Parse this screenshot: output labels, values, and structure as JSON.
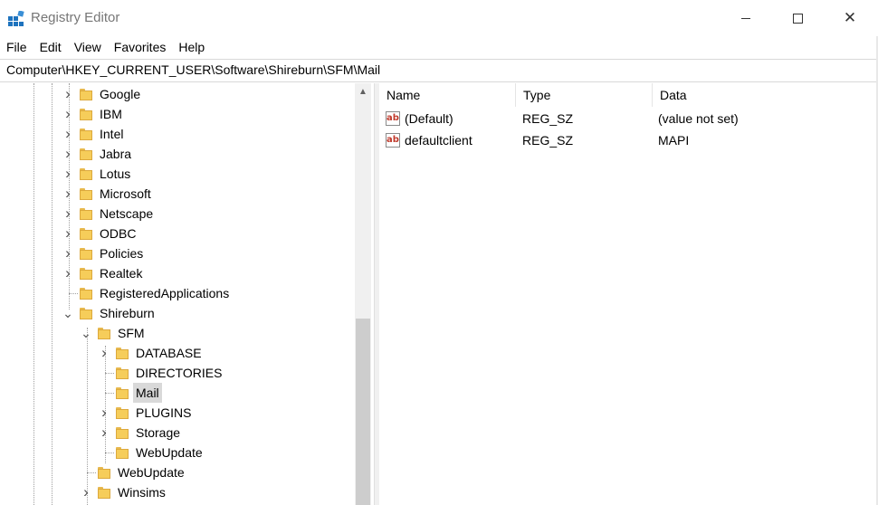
{
  "window": {
    "title": "Registry Editor",
    "icon": "registry-editor-icon",
    "controls": {
      "minimize": "minimize-icon",
      "maximize": "maximize-icon",
      "close": "close-icon"
    }
  },
  "menu": [
    "File",
    "Edit",
    "View",
    "Favorites",
    "Help"
  ],
  "address": "Computer\\HKEY_CURRENT_USER\\Software\\Shireburn\\SFM\\Mail",
  "tree": [
    {
      "label": "Google",
      "level": 0,
      "expander": "collapsed"
    },
    {
      "label": "IBM",
      "level": 0,
      "expander": "collapsed"
    },
    {
      "label": "Intel",
      "level": 0,
      "expander": "collapsed"
    },
    {
      "label": "Jabra",
      "level": 0,
      "expander": "collapsed"
    },
    {
      "label": "Lotus",
      "level": 0,
      "expander": "collapsed"
    },
    {
      "label": "Microsoft",
      "level": 0,
      "expander": "collapsed"
    },
    {
      "label": "Netscape",
      "level": 0,
      "expander": "collapsed"
    },
    {
      "label": "ODBC",
      "level": 0,
      "expander": "collapsed"
    },
    {
      "label": "Policies",
      "level": 0,
      "expander": "collapsed"
    },
    {
      "label": "Realtek",
      "level": 0,
      "expander": "collapsed"
    },
    {
      "label": "RegisteredApplications",
      "level": 0,
      "expander": "none"
    },
    {
      "label": "Shireburn",
      "level": 0,
      "expander": "expanded"
    },
    {
      "label": "SFM",
      "level": 1,
      "expander": "expanded"
    },
    {
      "label": "DATABASE",
      "level": 2,
      "expander": "collapsed"
    },
    {
      "label": "DIRECTORIES",
      "level": 2,
      "expander": "none"
    },
    {
      "label": "Mail",
      "level": 2,
      "expander": "none",
      "selected": true
    },
    {
      "label": "PLUGINS",
      "level": 2,
      "expander": "collapsed"
    },
    {
      "label": "Storage",
      "level": 2,
      "expander": "collapsed"
    },
    {
      "label": "WebUpdate",
      "level": 2,
      "expander": "none"
    },
    {
      "label": "WebUpdate",
      "level": 1,
      "expander": "none"
    },
    {
      "label": "Winsims",
      "level": 1,
      "expander": "collapsed"
    }
  ],
  "values": {
    "columns": [
      "Name",
      "Type",
      "Data"
    ],
    "rows": [
      {
        "icon": "string-value-icon",
        "icon_text": "ab",
        "name": "(Default)",
        "type": "REG_SZ",
        "data": "(value not set)"
      },
      {
        "icon": "string-value-icon",
        "icon_text": "ab",
        "name": "defaultclient",
        "type": "REG_SZ",
        "data": "MAPI"
      }
    ]
  },
  "colors": {
    "folder": "#f6cd5a",
    "selection": "#d9d9d9",
    "scroll_thumb": "#cdcdcd"
  }
}
